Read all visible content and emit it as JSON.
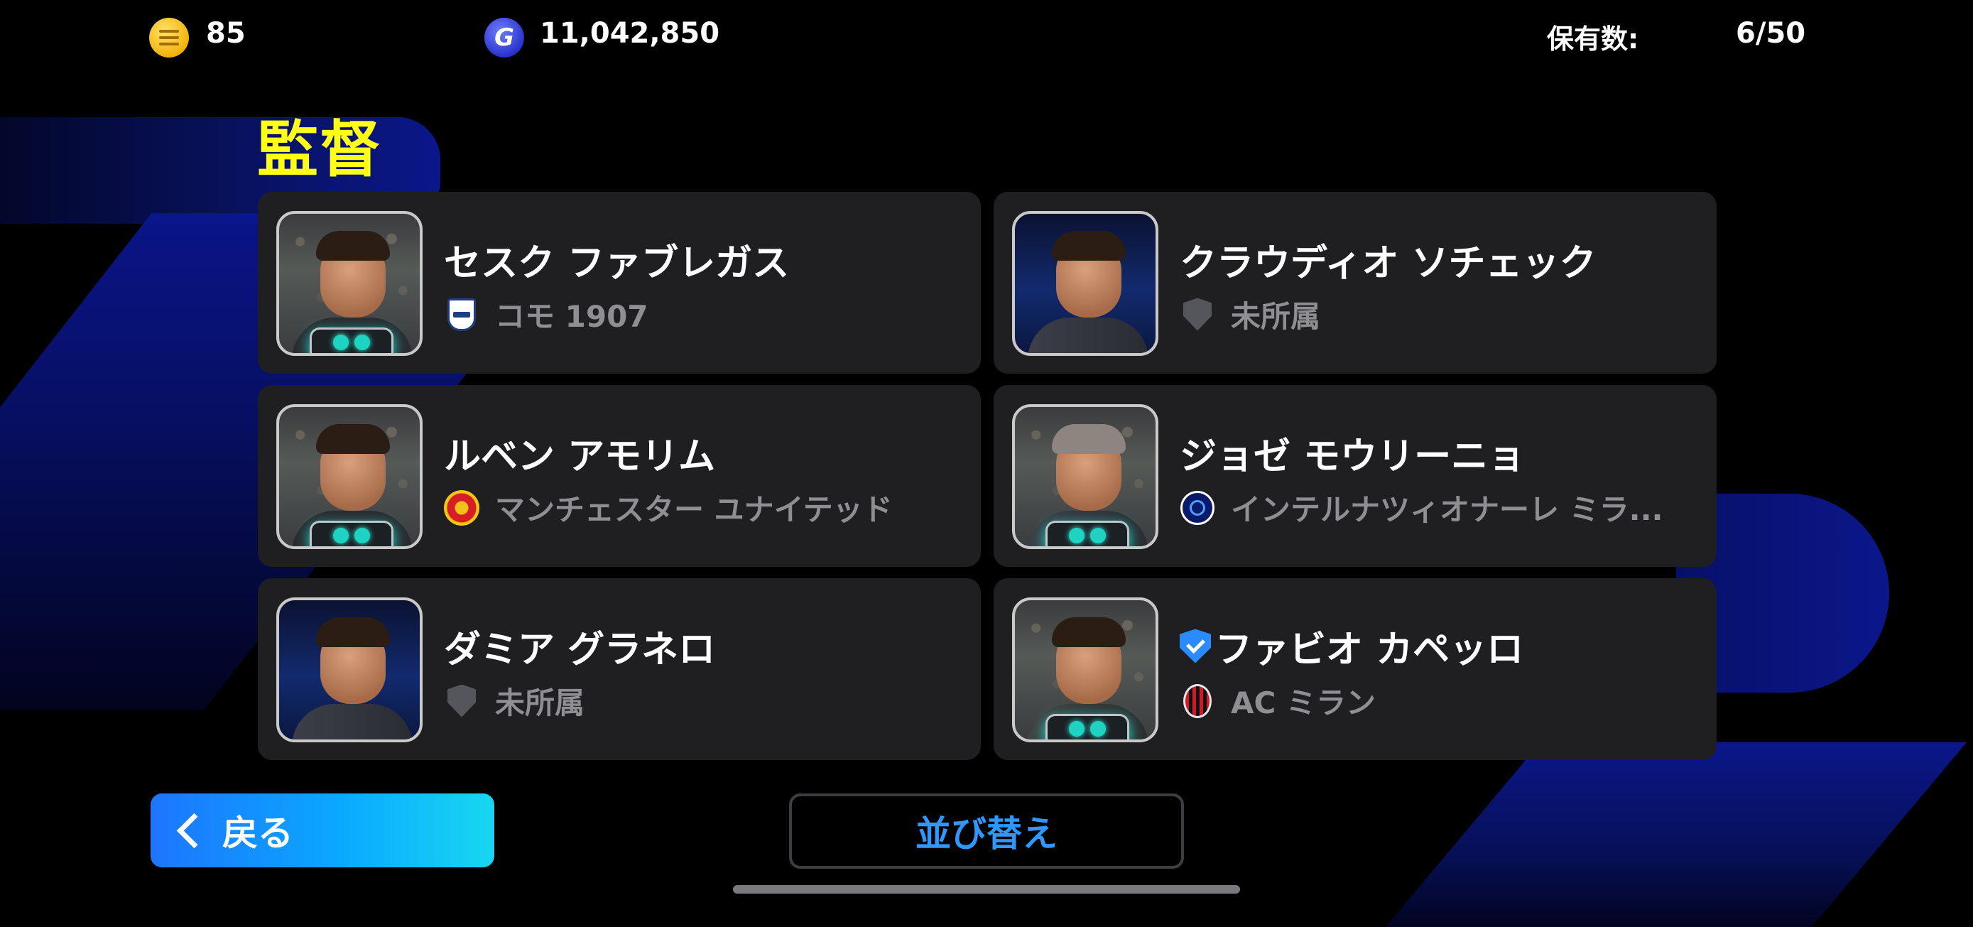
{
  "topbar": {
    "coins": "85",
    "gp": "11,042,850",
    "owned_label": "保有数:",
    "owned_value": "6/50"
  },
  "title": "監督",
  "managers": [
    {
      "name": "セスク ファブレガス",
      "club": "コモ 1907",
      "club_icon": "como-crest-icon",
      "verified": false
    },
    {
      "name": "クラウディオ ソチェック",
      "club": "未所属",
      "club_icon": "no-club-shield-icon",
      "verified": false
    },
    {
      "name": "ルベン アモリム",
      "club": "マンチェスター ユナイテッド",
      "club_icon": "man-utd-crest-icon",
      "verified": false
    },
    {
      "name": "ジョゼ モウリーニョ",
      "club": "インテルナツィオナーレ ミラ...",
      "club_icon": "inter-crest-icon",
      "verified": false
    },
    {
      "name": "ダミア グラネロ",
      "club": "未所属",
      "club_icon": "no-club-shield-icon",
      "verified": false
    },
    {
      "name": "ファビオ カペッロ",
      "club": "AC ミラン",
      "club_icon": "ac-milan-crest-icon",
      "verified": true
    }
  ],
  "buttons": {
    "back": "戻る",
    "sort": "並び替え"
  },
  "colors": {
    "title": "#ffff18",
    "sort_text": "#2e98ff",
    "accent_badge": "#1fd3c2"
  }
}
